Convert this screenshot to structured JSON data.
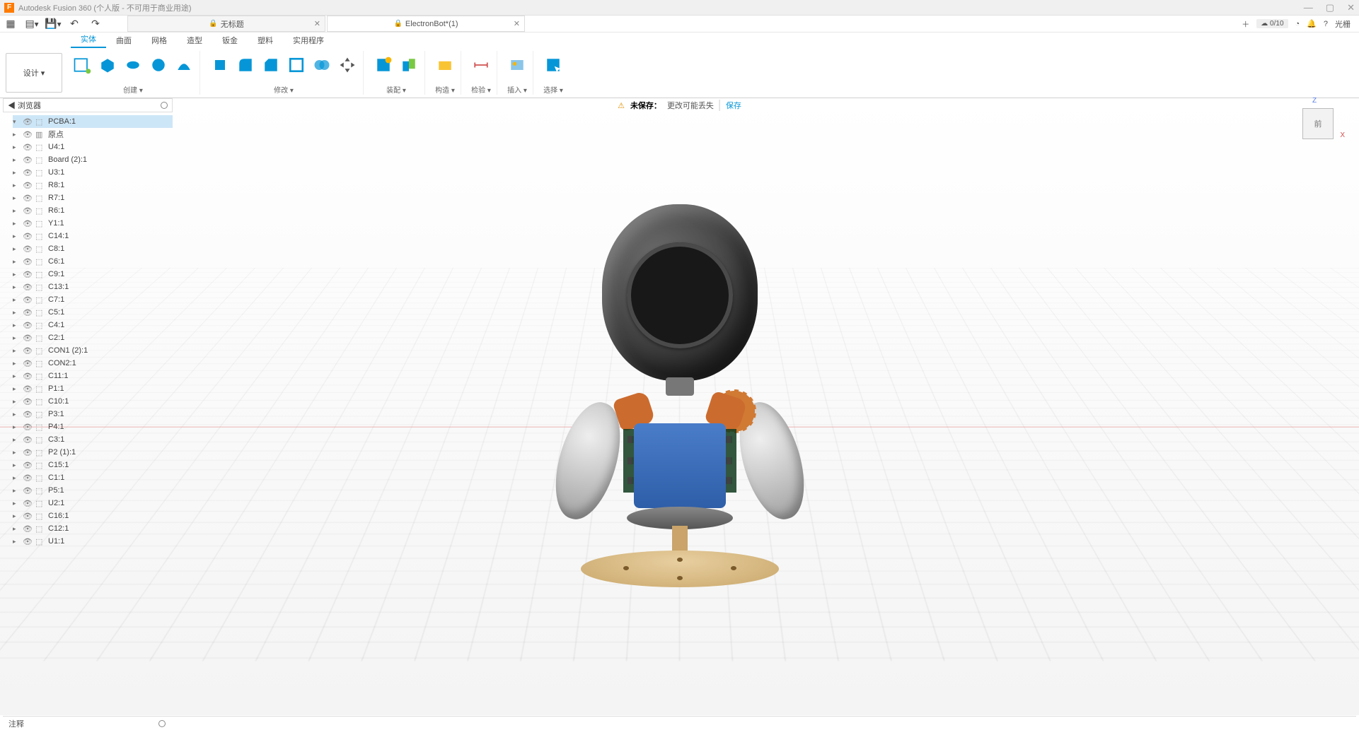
{
  "app": {
    "title": "Autodesk Fusion 360 (个人版 - 不可用于商业用途)",
    "logo_letter": "F"
  },
  "window_controls": {
    "min": "—",
    "max": "▢",
    "close": "✕"
  },
  "tabs": [
    {
      "label": "无标题",
      "locked": true,
      "active": false
    },
    {
      "label": "ElectronBot*(1)",
      "locked": true,
      "active": true
    }
  ],
  "quick_right": {
    "new": "＋",
    "cloud": "0/10",
    "ext_label": "光栅"
  },
  "design_button": "设计 ▾",
  "ribbon_tabs": [
    {
      "label": "实体",
      "active": true
    },
    {
      "label": "曲面",
      "active": false
    },
    {
      "label": "网格",
      "active": false
    },
    {
      "label": "造型",
      "active": false
    },
    {
      "label": "钣金",
      "active": false
    },
    {
      "label": "塑料",
      "active": false
    },
    {
      "label": "实用程序",
      "active": false
    }
  ],
  "ribbon_groups": {
    "create": "创建 ▾",
    "modify": "修改 ▾",
    "assemble": "装配 ▾",
    "construct": "构造 ▾",
    "inspect": "检验 ▾",
    "insert": "插入 ▾",
    "select": "选择 ▾"
  },
  "save_banner": {
    "warn_icon": "⚠",
    "unsaved": "未保存：",
    "msg": "更改可能丢失",
    "save": "保存"
  },
  "browser": {
    "title": "◀ 浏览器",
    "root": "PCBA:1",
    "origin": "原点",
    "items": [
      "U4:1",
      "Board (2):1",
      "U3:1",
      "R8:1",
      "R7:1",
      "R6:1",
      "Y1:1",
      "C14:1",
      "C8:1",
      "C6:1",
      "C9:1",
      "C13:1",
      "C7:1",
      "C5:1",
      "C4:1",
      "C2:1",
      "CON1 (2):1",
      "CON2:1",
      "C11:1",
      "P1:1",
      "C10:1",
      "P3:1",
      "P4:1",
      "C3:1",
      "P2 (1):1",
      "C15:1",
      "C1:1",
      "P5:1",
      "U2:1",
      "C16:1",
      "C12:1",
      "U1:1"
    ]
  },
  "viewcube": {
    "face": "前",
    "z": "Z",
    "x": "X"
  },
  "comment_label": "注释"
}
